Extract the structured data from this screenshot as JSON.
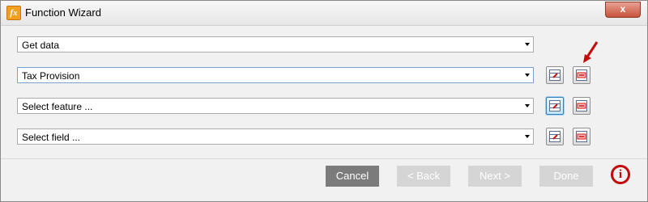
{
  "window": {
    "title": "Function Wizard",
    "icon_label": "fx",
    "close_label": "x"
  },
  "rows": [
    {
      "value": "Get data"
    },
    {
      "value": "Tax Provision"
    },
    {
      "value": "Select feature ..."
    },
    {
      "value": "Select field ..."
    }
  ],
  "footer": {
    "cancel_label": "Cancel",
    "back_label": "< Back",
    "next_label": "Next >",
    "done_label": "Done",
    "info_label": "i"
  },
  "colors": {
    "accent_red": "#c40a0a",
    "cancel_bg": "#7b7b7b",
    "disabled_bg": "#d5d5d5"
  }
}
